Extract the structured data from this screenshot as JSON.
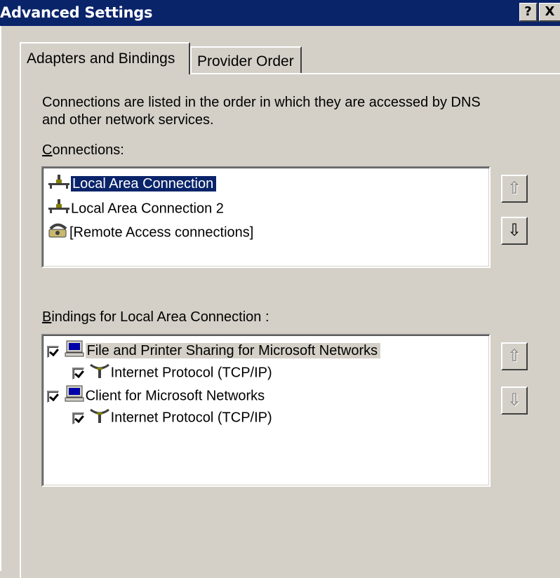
{
  "window": {
    "title": "Advanced Settings",
    "help_glyph": "?",
    "close_glyph": "X"
  },
  "tabs": [
    {
      "label": "Adapters and Bindings",
      "active": true
    },
    {
      "label": "Provider Order",
      "active": false
    }
  ],
  "description": "Connections are listed in the order in which they are accessed by DNS and other network services.",
  "connections": {
    "label_accel": "C",
    "label_rest": "onnections:",
    "items": [
      {
        "label": "Local Area Connection",
        "icon": "network-adapter-icon",
        "selected": true
      },
      {
        "label": "Local Area Connection 2",
        "icon": "network-adapter-icon",
        "selected": false
      },
      {
        "label": "[Remote Access connections]",
        "icon": "modem-phone-icon",
        "selected": false
      }
    ],
    "up_glyph": "⇧",
    "down_glyph": "⇩"
  },
  "bindings": {
    "label_accel": "B",
    "label_rest": "indings for Local Area Connection :",
    "items": [
      {
        "label": "File and Printer Sharing for Microsoft Networks",
        "icon": "computer-icon",
        "checked": true,
        "level": 0,
        "highlighted": true
      },
      {
        "label": "Internet Protocol (TCP/IP)",
        "icon": "protocol-icon",
        "checked": true,
        "level": 1
      },
      {
        "label": "Client for Microsoft Networks",
        "icon": "computer-icon",
        "checked": true,
        "level": 0
      },
      {
        "label": "Internet Protocol (TCP/IP)",
        "icon": "protocol-icon",
        "checked": true,
        "level": 1
      }
    ],
    "up_glyph": "⇧",
    "down_glyph": "⇩"
  },
  "colors": {
    "title_bar": "#0a246a",
    "face": "#d4d0c8",
    "selection": "#0a246a"
  }
}
